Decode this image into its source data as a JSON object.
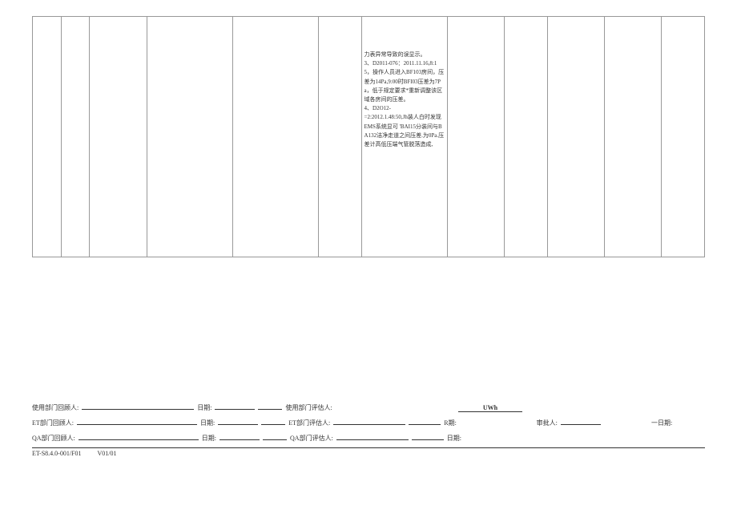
{
  "table": {
    "cell_content": "力表异常导致的误显示。\n3、D2011-076：2011.11.16,8:15，操作人员进入BF103房间，压差为14Pa,9:00时BFI03压差为7Pa，低于规定要求*重新调整该区域各房间的压差。\n4、D2O12-\n=2:2012.1.48:50,Jh装人白时发现EMS系统显可 'BAI15分装间与BA132洁净走道之间压差.为0Pa.压差计高低压端气管脱落造成,"
  },
  "signatures": {
    "user_reviewer_label": "使用部门回顾人:",
    "et_reviewer_label": "ET部门回顾人:",
    "qa_reviewer_label": "QA部门回顾人:",
    "date_label": "日期:",
    "user_assessor_label": "使用部门评估人:",
    "et_assessor_label": "ET部门评估人:",
    "qa_assessor_label": "QA部门评估人:",
    "uwh_text": "UWh",
    "r_label": "R期:",
    "approver_label": "审批人:",
    "dash_date_label": "一日期:"
  },
  "footer": {
    "doc_code": "ET-S8.4.0-001/F01",
    "version": "V01/01"
  }
}
